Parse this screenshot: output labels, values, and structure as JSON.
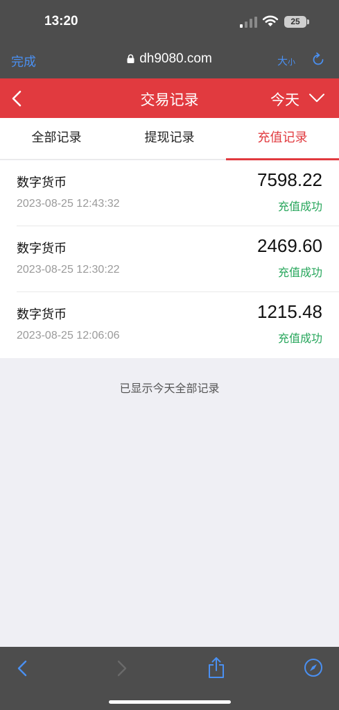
{
  "status_bar": {
    "time": "13:20",
    "battery": "25"
  },
  "browser": {
    "done_label": "完成",
    "url": "dh9080.com",
    "size_label_big": "大",
    "size_label_small": "小"
  },
  "header": {
    "title": "交易记录",
    "date_filter": "今天"
  },
  "tabs": [
    {
      "label": "全部记录",
      "active": false
    },
    {
      "label": "提现记录",
      "active": false
    },
    {
      "label": "充值记录",
      "active": true
    }
  ],
  "records": [
    {
      "name": "数字货币",
      "time": "2023-08-25 12:43:32",
      "amount": "7598.22",
      "status": "充值成功"
    },
    {
      "name": "数字货币",
      "time": "2023-08-25 12:30:22",
      "amount": "2469.60",
      "status": "充值成功"
    },
    {
      "name": "数字货币",
      "time": "2023-08-25 12:06:06",
      "amount": "1215.48",
      "status": "充值成功"
    }
  ],
  "footer_note": "已显示今天全部记录",
  "colors": {
    "accent_red": "#e13a3f",
    "success_green": "#26a65b",
    "link_blue": "#4a90f2"
  },
  "icons": [
    "signal-icon",
    "wifi-icon",
    "battery-icon",
    "lock-icon",
    "reload-icon",
    "back-icon",
    "chevron-down-icon",
    "nav-back-icon",
    "nav-forward-icon",
    "share-icon",
    "compass-icon"
  ]
}
